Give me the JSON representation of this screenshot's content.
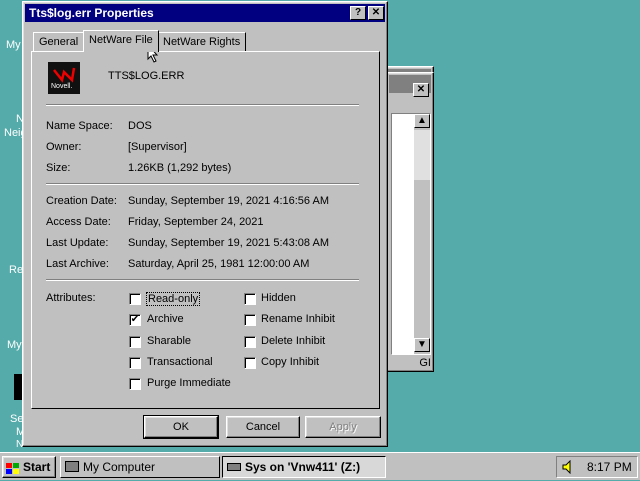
{
  "desktop": {
    "icons": [
      "My",
      "N",
      "Neig",
      "Re",
      "My",
      "Se",
      "M",
      "Netwo"
    ]
  },
  "bg_window": {
    "title_fragment": "",
    "status_fragment": "GI"
  },
  "dialog": {
    "title": "Tts$log.err Properties",
    "help_btn": "?",
    "close_btn": "✕",
    "tabs": [
      "General",
      "NetWare File",
      "NetWare Rights"
    ],
    "active_tab": "NetWare File",
    "logo_text": "Novell.",
    "file_name": "TTS$LOG.ERR",
    "info1": [
      {
        "label": "Name Space:",
        "value": "DOS"
      },
      {
        "label": "Owner:",
        "value": "[Supervisor]"
      },
      {
        "label": "Size:",
        "value": "1.26KB (1,292 bytes)"
      }
    ],
    "info2": [
      {
        "label": "Creation Date:",
        "value": "Sunday, September 19, 2021 4:16:56 AM"
      },
      {
        "label": "Access Date:",
        "value": "Friday, September 24, 2021"
      },
      {
        "label": "Last Update:",
        "value": "Sunday, September 19, 2021 5:43:08 AM"
      },
      {
        "label": "Last Archive:",
        "value": "Saturday, April 25, 1981 12:00:00 AM"
      }
    ],
    "attributes_label": "Attributes:",
    "attributes_left": [
      {
        "label": "Read-only",
        "checked": false
      },
      {
        "label": "Archive",
        "checked": true
      },
      {
        "label": "Sharable",
        "checked": false
      },
      {
        "label": "Transactional",
        "checked": false
      },
      {
        "label": "Purge Immediate",
        "checked": false
      }
    ],
    "attributes_right": [
      {
        "label": "Hidden",
        "checked": false
      },
      {
        "label": "Rename Inhibit",
        "checked": false
      },
      {
        "label": "Delete Inhibit",
        "checked": false
      },
      {
        "label": "Copy Inhibit",
        "checked": false
      }
    ],
    "ok": "OK",
    "cancel": "Cancel",
    "apply": "Apply"
  },
  "taskbar": {
    "start": "Start",
    "tasks": [
      "My Computer",
      "Sys on 'Vnw411' (Z:)"
    ],
    "clock": "8:17 PM"
  }
}
